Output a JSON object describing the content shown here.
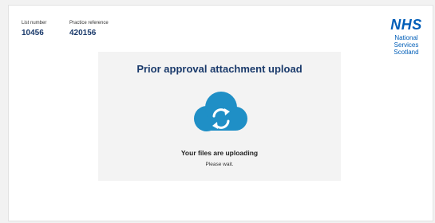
{
  "header": {
    "list_number_label": "List number",
    "list_number_value": "10456",
    "practice_reference_label": "Practice reference",
    "practice_reference_value": "420156"
  },
  "logo": {
    "brand": "NHS",
    "line1": "National",
    "line2": "Services",
    "line3": "Scotland",
    "color": "#005eb8"
  },
  "panel": {
    "title": "Prior approval attachment upload",
    "icon": "cloud-sync-icon",
    "status": "Your files are uploading",
    "message": "Please wait."
  },
  "colors": {
    "title": "#1a3a6b",
    "cloud": "#1f8fc6",
    "panel_bg": "#f3f3f3"
  }
}
